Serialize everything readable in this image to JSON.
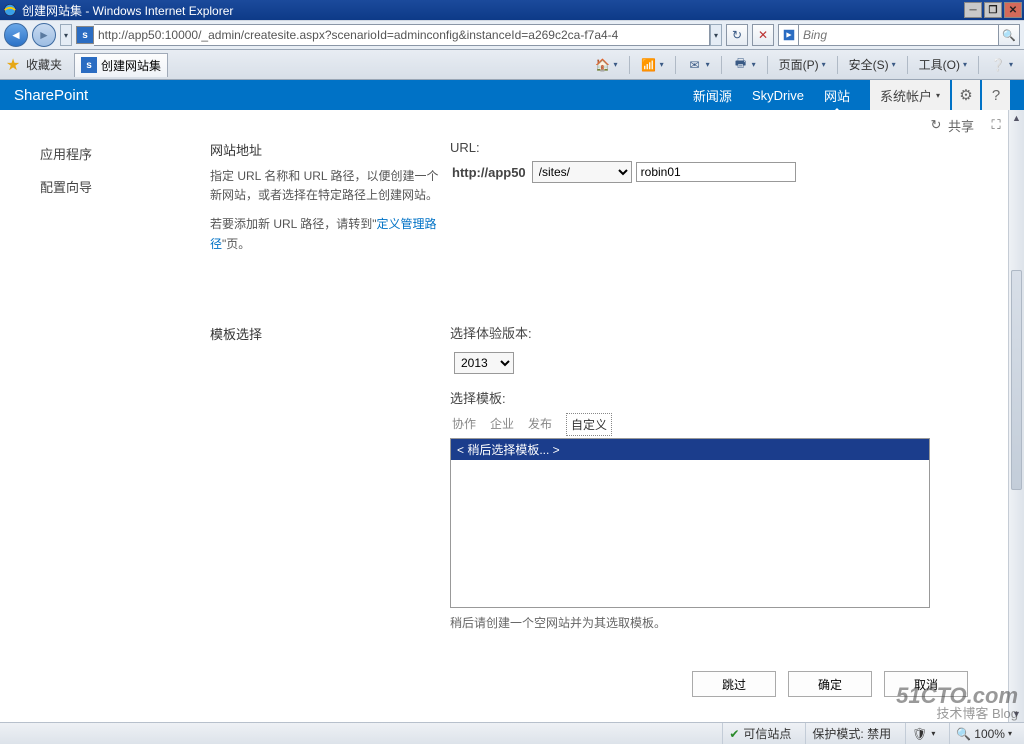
{
  "window": {
    "title": "创建网站集 - Windows Internet Explorer"
  },
  "ie": {
    "address": "http://app50:10000/_admin/createsite.aspx?scenarioId=adminconfig&instanceId=a269c2ca-f7a4-4",
    "search_placeholder": "Bing",
    "fav_label": "收藏夹",
    "tab_title": "创建网站集",
    "menu": {
      "page": "页面(P)",
      "safety": "安全(S)",
      "tools": "工具(O)"
    },
    "status": {
      "trusted": "可信站点",
      "protected": "保护模式: 禁用",
      "zoom": "100%"
    }
  },
  "suite": {
    "brand": "SharePoint",
    "newsfeed": "新闻源",
    "skydrive": "SkyDrive",
    "sites": "网站",
    "account": "系统帐户"
  },
  "ribbon": {
    "share": "共享"
  },
  "nav": {
    "apps": "应用程序",
    "wizard": "配置向导"
  },
  "section_addr": {
    "title": "网站地址",
    "desc1": "指定 URL 名称和 URL 路径，以便创建一个新网站，或者选择在特定路径上创建网站。",
    "desc2_a": "若要添加新 URL 路径，请转到\"",
    "link": "定义管理路径",
    "desc2_b": "\"页。"
  },
  "section_tmpl": {
    "title": "模板选择"
  },
  "form": {
    "url_label": "URL:",
    "url_host": "http://app50",
    "url_path_value": "/sites/",
    "url_name_value": "robin01",
    "exp_label": "选择体验版本:",
    "exp_value": "2013",
    "tmpl_label": "选择模板:",
    "tabs": {
      "collab": "协作",
      "enterprise": "企业",
      "publish": "发布",
      "custom": "自定义"
    },
    "tmpl_item": "< 稍后选择模板... >",
    "tmpl_note": "稍后请创建一个空网站并为其选取模板。",
    "btn_skip": "跳过",
    "btn_ok": "确定",
    "btn_cancel": "取消"
  },
  "watermark": {
    "main": "51CTO.com",
    "sub": "技术博客  Blog"
  }
}
